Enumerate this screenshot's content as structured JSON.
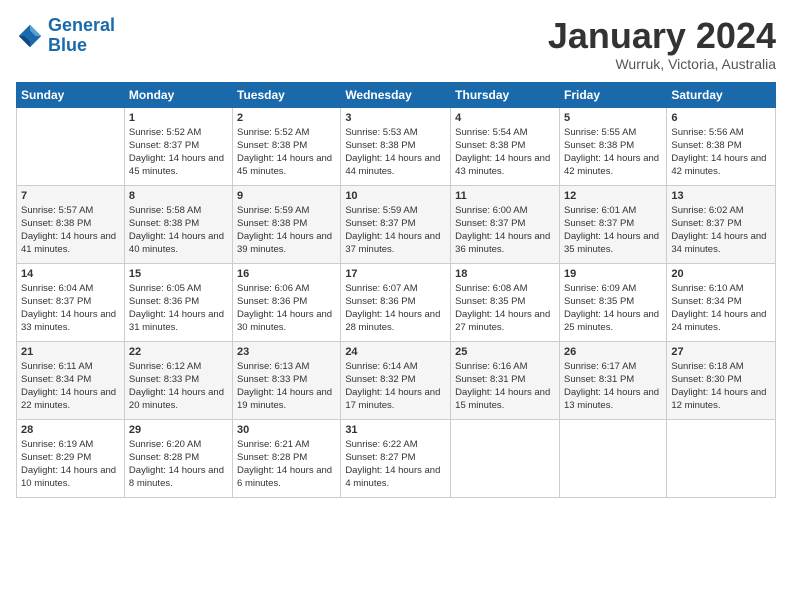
{
  "header": {
    "logo_line1": "General",
    "logo_line2": "Blue",
    "month": "January 2024",
    "location": "Wurruk, Victoria, Australia"
  },
  "weekdays": [
    "Sunday",
    "Monday",
    "Tuesday",
    "Wednesday",
    "Thursday",
    "Friday",
    "Saturday"
  ],
  "weeks": [
    [
      {
        "day": "",
        "sunrise": "",
        "sunset": "",
        "daylight": ""
      },
      {
        "day": "1",
        "sunrise": "Sunrise: 5:52 AM",
        "sunset": "Sunset: 8:37 PM",
        "daylight": "Daylight: 14 hours and 45 minutes."
      },
      {
        "day": "2",
        "sunrise": "Sunrise: 5:52 AM",
        "sunset": "Sunset: 8:38 PM",
        "daylight": "Daylight: 14 hours and 45 minutes."
      },
      {
        "day": "3",
        "sunrise": "Sunrise: 5:53 AM",
        "sunset": "Sunset: 8:38 PM",
        "daylight": "Daylight: 14 hours and 44 minutes."
      },
      {
        "day": "4",
        "sunrise": "Sunrise: 5:54 AM",
        "sunset": "Sunset: 8:38 PM",
        "daylight": "Daylight: 14 hours and 43 minutes."
      },
      {
        "day": "5",
        "sunrise": "Sunrise: 5:55 AM",
        "sunset": "Sunset: 8:38 PM",
        "daylight": "Daylight: 14 hours and 42 minutes."
      },
      {
        "day": "6",
        "sunrise": "Sunrise: 5:56 AM",
        "sunset": "Sunset: 8:38 PM",
        "daylight": "Daylight: 14 hours and 42 minutes."
      }
    ],
    [
      {
        "day": "7",
        "sunrise": "Sunrise: 5:57 AM",
        "sunset": "Sunset: 8:38 PM",
        "daylight": "Daylight: 14 hours and 41 minutes."
      },
      {
        "day": "8",
        "sunrise": "Sunrise: 5:58 AM",
        "sunset": "Sunset: 8:38 PM",
        "daylight": "Daylight: 14 hours and 40 minutes."
      },
      {
        "day": "9",
        "sunrise": "Sunrise: 5:59 AM",
        "sunset": "Sunset: 8:38 PM",
        "daylight": "Daylight: 14 hours and 39 minutes."
      },
      {
        "day": "10",
        "sunrise": "Sunrise: 5:59 AM",
        "sunset": "Sunset: 8:37 PM",
        "daylight": "Daylight: 14 hours and 37 minutes."
      },
      {
        "day": "11",
        "sunrise": "Sunrise: 6:00 AM",
        "sunset": "Sunset: 8:37 PM",
        "daylight": "Daylight: 14 hours and 36 minutes."
      },
      {
        "day": "12",
        "sunrise": "Sunrise: 6:01 AM",
        "sunset": "Sunset: 8:37 PM",
        "daylight": "Daylight: 14 hours and 35 minutes."
      },
      {
        "day": "13",
        "sunrise": "Sunrise: 6:02 AM",
        "sunset": "Sunset: 8:37 PM",
        "daylight": "Daylight: 14 hours and 34 minutes."
      }
    ],
    [
      {
        "day": "14",
        "sunrise": "Sunrise: 6:04 AM",
        "sunset": "Sunset: 8:37 PM",
        "daylight": "Daylight: 14 hours and 33 minutes."
      },
      {
        "day": "15",
        "sunrise": "Sunrise: 6:05 AM",
        "sunset": "Sunset: 8:36 PM",
        "daylight": "Daylight: 14 hours and 31 minutes."
      },
      {
        "day": "16",
        "sunrise": "Sunrise: 6:06 AM",
        "sunset": "Sunset: 8:36 PM",
        "daylight": "Daylight: 14 hours and 30 minutes."
      },
      {
        "day": "17",
        "sunrise": "Sunrise: 6:07 AM",
        "sunset": "Sunset: 8:36 PM",
        "daylight": "Daylight: 14 hours and 28 minutes."
      },
      {
        "day": "18",
        "sunrise": "Sunrise: 6:08 AM",
        "sunset": "Sunset: 8:35 PM",
        "daylight": "Daylight: 14 hours and 27 minutes."
      },
      {
        "day": "19",
        "sunrise": "Sunrise: 6:09 AM",
        "sunset": "Sunset: 8:35 PM",
        "daylight": "Daylight: 14 hours and 25 minutes."
      },
      {
        "day": "20",
        "sunrise": "Sunrise: 6:10 AM",
        "sunset": "Sunset: 8:34 PM",
        "daylight": "Daylight: 14 hours and 24 minutes."
      }
    ],
    [
      {
        "day": "21",
        "sunrise": "Sunrise: 6:11 AM",
        "sunset": "Sunset: 8:34 PM",
        "daylight": "Daylight: 14 hours and 22 minutes."
      },
      {
        "day": "22",
        "sunrise": "Sunrise: 6:12 AM",
        "sunset": "Sunset: 8:33 PM",
        "daylight": "Daylight: 14 hours and 20 minutes."
      },
      {
        "day": "23",
        "sunrise": "Sunrise: 6:13 AM",
        "sunset": "Sunset: 8:33 PM",
        "daylight": "Daylight: 14 hours and 19 minutes."
      },
      {
        "day": "24",
        "sunrise": "Sunrise: 6:14 AM",
        "sunset": "Sunset: 8:32 PM",
        "daylight": "Daylight: 14 hours and 17 minutes."
      },
      {
        "day": "25",
        "sunrise": "Sunrise: 6:16 AM",
        "sunset": "Sunset: 8:31 PM",
        "daylight": "Daylight: 14 hours and 15 minutes."
      },
      {
        "day": "26",
        "sunrise": "Sunrise: 6:17 AM",
        "sunset": "Sunset: 8:31 PM",
        "daylight": "Daylight: 14 hours and 13 minutes."
      },
      {
        "day": "27",
        "sunrise": "Sunrise: 6:18 AM",
        "sunset": "Sunset: 8:30 PM",
        "daylight": "Daylight: 14 hours and 12 minutes."
      }
    ],
    [
      {
        "day": "28",
        "sunrise": "Sunrise: 6:19 AM",
        "sunset": "Sunset: 8:29 PM",
        "daylight": "Daylight: 14 hours and 10 minutes."
      },
      {
        "day": "29",
        "sunrise": "Sunrise: 6:20 AM",
        "sunset": "Sunset: 8:28 PM",
        "daylight": "Daylight: 14 hours and 8 minutes."
      },
      {
        "day": "30",
        "sunrise": "Sunrise: 6:21 AM",
        "sunset": "Sunset: 8:28 PM",
        "daylight": "Daylight: 14 hours and 6 minutes."
      },
      {
        "day": "31",
        "sunrise": "Sunrise: 6:22 AM",
        "sunset": "Sunset: 8:27 PM",
        "daylight": "Daylight: 14 hours and 4 minutes."
      },
      {
        "day": "",
        "sunrise": "",
        "sunset": "",
        "daylight": ""
      },
      {
        "day": "",
        "sunrise": "",
        "sunset": "",
        "daylight": ""
      },
      {
        "day": "",
        "sunrise": "",
        "sunset": "",
        "daylight": ""
      }
    ]
  ]
}
